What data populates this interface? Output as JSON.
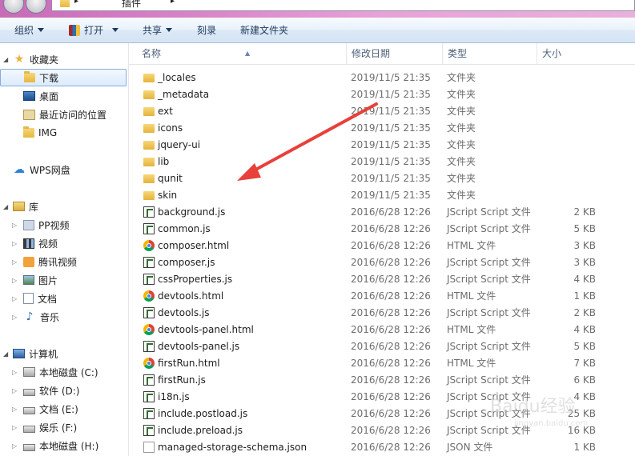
{
  "address": {
    "crumb": "插件"
  },
  "toolbar": {
    "organize": "组织",
    "open": "打开",
    "share": "共享",
    "burn": "刻录",
    "new_folder": "新建文件夹"
  },
  "nav": {
    "favorites": "收藏夹",
    "downloads": "下载",
    "desktop": "桌面",
    "recent": "最近访问的位置",
    "img": "IMG",
    "wps": "WPS网盘",
    "libraries": "库",
    "pp_video": "PP视频",
    "video": "视频",
    "tencent_video": "腾讯视频",
    "pictures": "图片",
    "documents": "文档",
    "music": "音乐",
    "computer": "计算机",
    "drive_c": "本地磁盘 (C:)",
    "drive_d": "软件 (D:)",
    "drive_e": "文档 (E:)",
    "drive_f": "娱乐 (F:)",
    "drive_h": "本地磁盘 (H:)"
  },
  "columns": {
    "name": "名称",
    "date": "修改日期",
    "type": "类型",
    "size": "大小"
  },
  "files": [
    {
      "kind": "folder",
      "name": "_locales",
      "date": "2019/11/5 21:35",
      "type": "文件夹",
      "size": ""
    },
    {
      "kind": "folder",
      "name": "_metadata",
      "date": "2019/11/5 21:35",
      "type": "文件夹",
      "size": ""
    },
    {
      "kind": "folder",
      "name": "ext",
      "date": "2019/11/5 21:35",
      "type": "文件夹",
      "size": ""
    },
    {
      "kind": "folder",
      "name": "icons",
      "date": "2019/11/5 21:35",
      "type": "文件夹",
      "size": ""
    },
    {
      "kind": "folder",
      "name": "jquery-ui",
      "date": "2019/11/5 21:35",
      "type": "文件夹",
      "size": ""
    },
    {
      "kind": "folder",
      "name": "lib",
      "date": "2019/11/5 21:35",
      "type": "文件夹",
      "size": ""
    },
    {
      "kind": "folder",
      "name": "qunit",
      "date": "2019/11/5 21:35",
      "type": "文件夹",
      "size": ""
    },
    {
      "kind": "folder",
      "name": "skin",
      "date": "2019/11/5 21:35",
      "type": "文件夹",
      "size": ""
    },
    {
      "kind": "js",
      "name": "background.js",
      "date": "2016/6/28 12:26",
      "type": "JScript Script 文件",
      "size": "2 KB"
    },
    {
      "kind": "js",
      "name": "common.js",
      "date": "2016/6/28 12:26",
      "type": "JScript Script 文件",
      "size": "5 KB"
    },
    {
      "kind": "html",
      "name": "composer.html",
      "date": "2016/6/28 12:26",
      "type": "HTML 文件",
      "size": "3 KB"
    },
    {
      "kind": "js",
      "name": "composer.js",
      "date": "2016/6/28 12:26",
      "type": "JScript Script 文件",
      "size": "3 KB"
    },
    {
      "kind": "js",
      "name": "cssProperties.js",
      "date": "2016/6/28 12:26",
      "type": "JScript Script 文件",
      "size": "4 KB"
    },
    {
      "kind": "html",
      "name": "devtools.html",
      "date": "2016/6/28 12:26",
      "type": "HTML 文件",
      "size": "1 KB"
    },
    {
      "kind": "js",
      "name": "devtools.js",
      "date": "2016/6/28 12:26",
      "type": "JScript Script 文件",
      "size": "2 KB"
    },
    {
      "kind": "html",
      "name": "devtools-panel.html",
      "date": "2016/6/28 12:26",
      "type": "HTML 文件",
      "size": "4 KB"
    },
    {
      "kind": "js",
      "name": "devtools-panel.js",
      "date": "2016/6/28 12:26",
      "type": "JScript Script 文件",
      "size": "5 KB"
    },
    {
      "kind": "html",
      "name": "firstRun.html",
      "date": "2016/6/28 12:26",
      "type": "HTML 文件",
      "size": "7 KB"
    },
    {
      "kind": "js",
      "name": "firstRun.js",
      "date": "2016/6/28 12:26",
      "type": "JScript Script 文件",
      "size": "6 KB"
    },
    {
      "kind": "js",
      "name": "i18n.js",
      "date": "2016/6/28 12:26",
      "type": "JScript Script 文件",
      "size": "4 KB"
    },
    {
      "kind": "js",
      "name": "include.postload.js",
      "date": "2016/6/28 12:26",
      "type": "JScript Script 文件",
      "size": "25 KB"
    },
    {
      "kind": "js",
      "name": "include.preload.js",
      "date": "2016/6/28 12:26",
      "type": "JScript Script 文件",
      "size": "16 KB"
    },
    {
      "kind": "json",
      "name": "managed-storage-schema.json",
      "date": "2016/6/28 12:26",
      "type": "JSON 文件",
      "size": "1 KB"
    }
  ],
  "annotation": {
    "arrow_color": "#e8403a"
  },
  "watermark": {
    "main": "Baidu经验",
    "sub": "jingyan.baidu.com"
  }
}
